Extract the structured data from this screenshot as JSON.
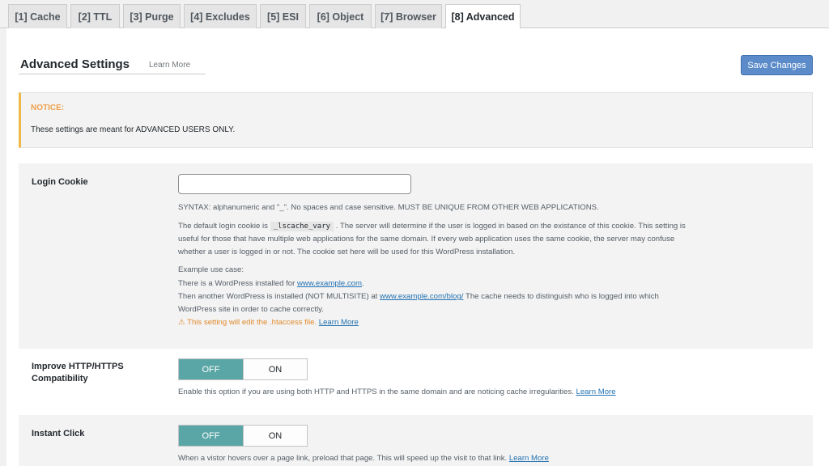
{
  "tabs": [
    "[1] Cache",
    "[2] TTL",
    "[3] Purge",
    "[4] Excludes",
    "[5] ESI",
    "[6] Object",
    "[7] Browser",
    "[8] Advanced"
  ],
  "header": {
    "title": "Advanced Settings",
    "learn_more": "Learn More",
    "save_label": "Save Changes"
  },
  "notice": {
    "title": "NOTICE:",
    "text": "These settings are meant for ADVANCED USERS ONLY."
  },
  "login_cookie": {
    "label": "Login Cookie",
    "value": "",
    "syntax": "SYNTAX: alphanumeric and \"_\". No spaces and case sensitive. MUST BE UNIQUE FROM OTHER WEB APPLICATIONS.",
    "desc_pre": "The default login cookie is",
    "desc_code": "_lscache_vary",
    "desc_post": ". The server will determine if the user is logged in based on the existance of this cookie. This setting is",
    "desc_line2": "useful for those that have multiple web applications for the same domain. If every web application uses the same cookie, the server may confuse",
    "desc_line3": "whether a user is logged in or not. The cookie set here will be used for this WordPress installation.",
    "example_title": "Example use case:",
    "example_line1_pre": "There is a WordPress installed for",
    "example_line1_link": "www.example.com",
    "example_line2_pre": "Then another WordPress is installed (NOT MULTISITE) at",
    "example_line2_link": "www.example.com/blog/",
    "example_line2_post": "The cache needs to distinguish who is logged into which",
    "example_line3": "WordPress site in order to cache correctly.",
    "warning_icon": "⚠",
    "warning_text": "This setting will edit the .htaccess file.",
    "warning_link": "Learn More"
  },
  "http_compat": {
    "label_line1": "Improve HTTP/HTTPS",
    "label_line2": "Compatibility",
    "off": "OFF",
    "on": "ON",
    "desc": "Enable this option if you are using both HTTP and HTTPS in the same domain and are noticing cache irregularities.",
    "link": "Learn More"
  },
  "instant_click": {
    "label": "Instant Click",
    "off": "OFF",
    "on": "ON",
    "desc": "When a vistor hovers over a page link, preload that page. This will speed up the visit to that link.",
    "link": "Learn More"
  }
}
